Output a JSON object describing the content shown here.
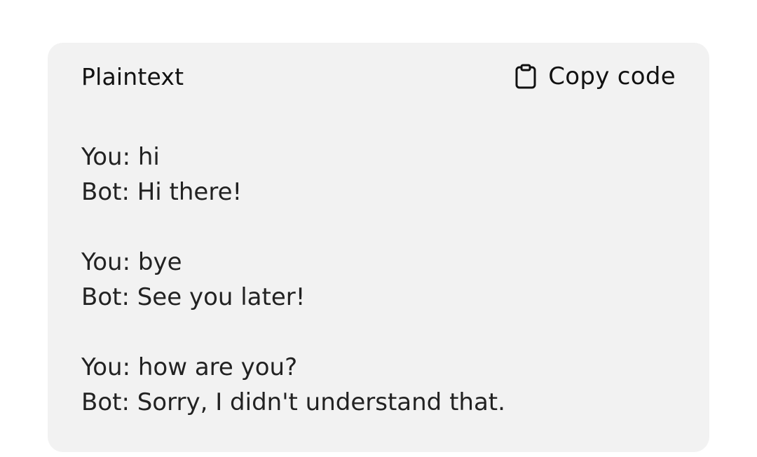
{
  "code_block": {
    "language_label": "Plaintext",
    "copy_label": "Copy code",
    "copy_icon": "clipboard-icon",
    "code": "You: hi\nBot: Hi there!\n\nYou: bye\nBot: See you later!\n\nYou: how are you?\nBot: Sorry, I didn't understand that."
  }
}
